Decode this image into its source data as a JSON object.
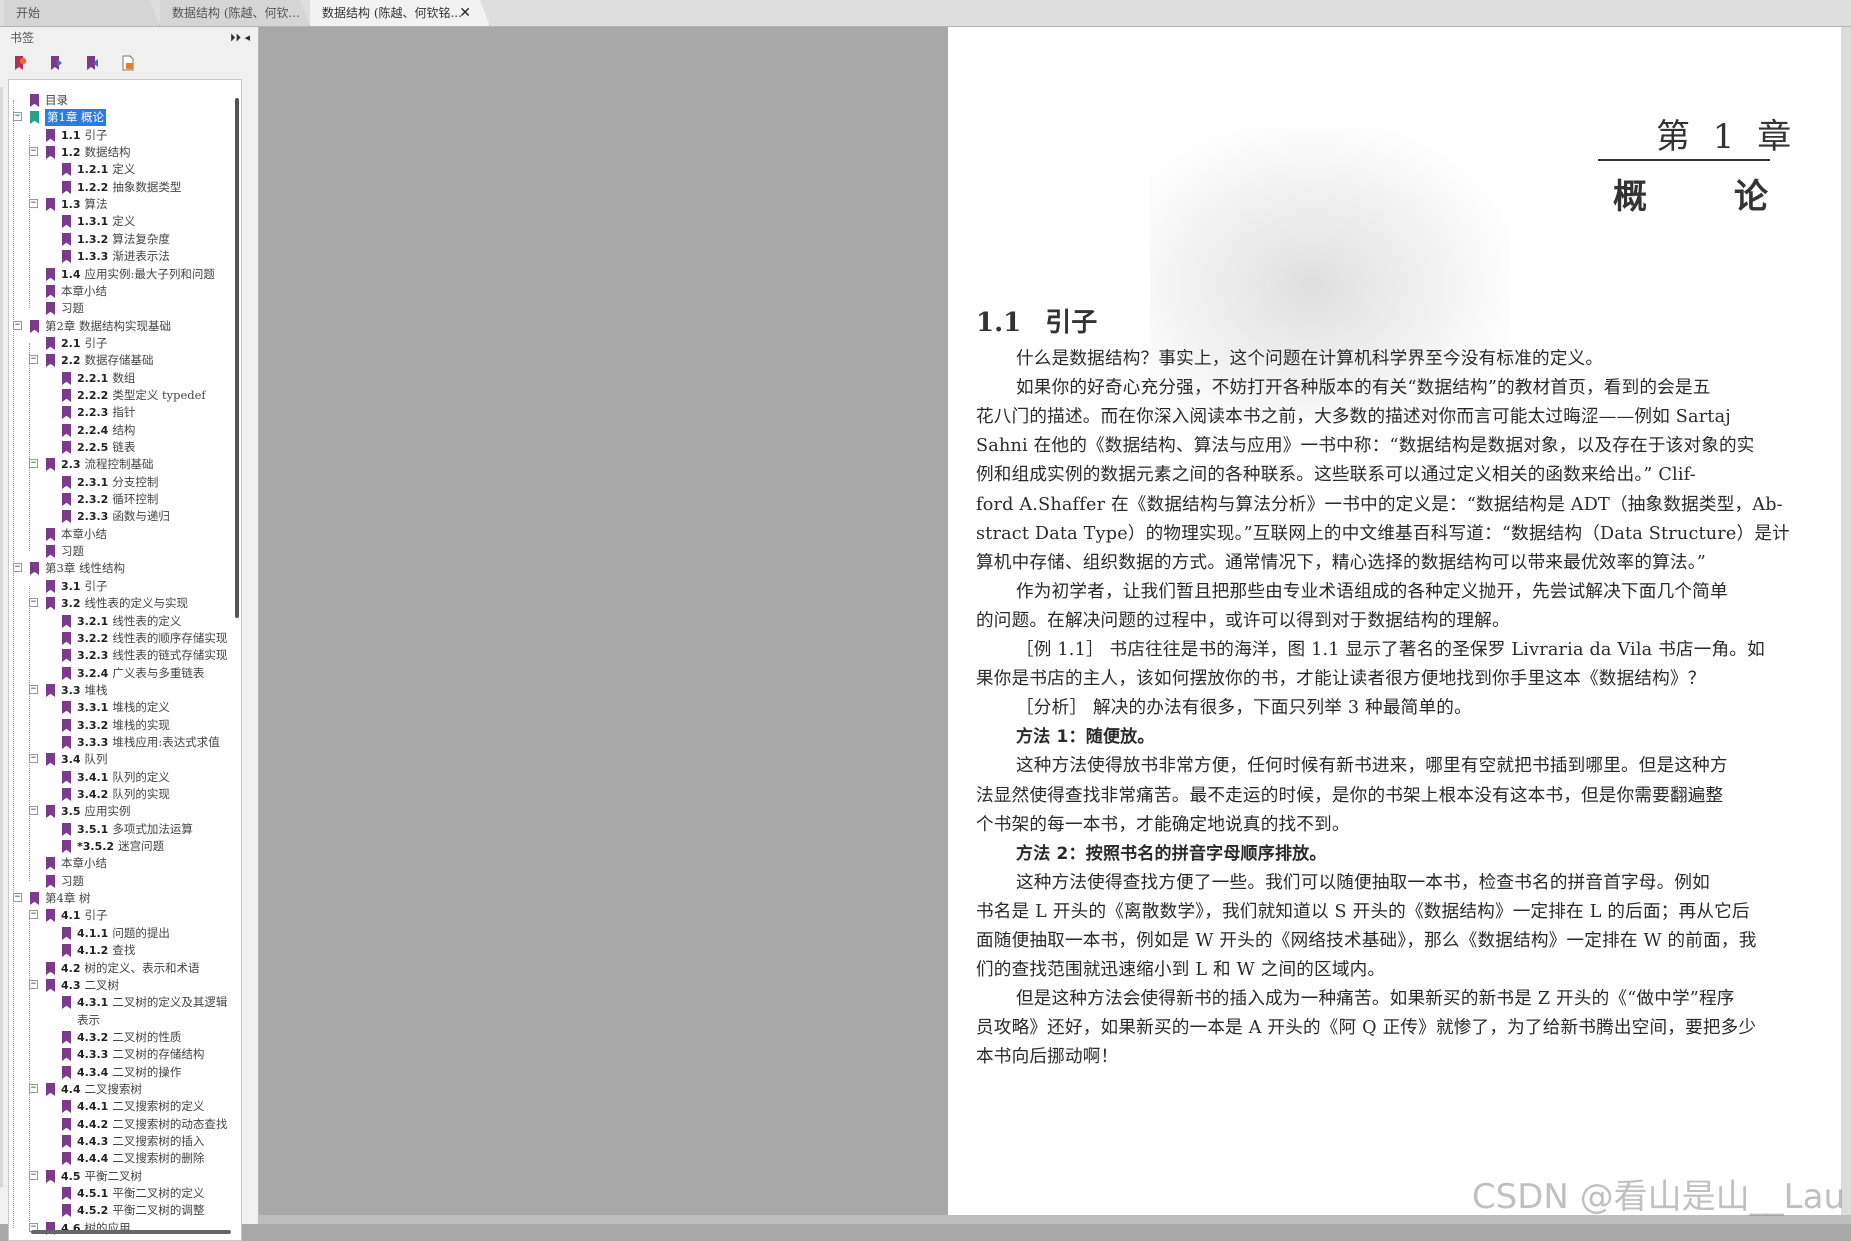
{
  "tabs": [
    {
      "label": "开始"
    },
    {
      "label": "数据结构 (陈越、何钦..."
    },
    {
      "label": "数据结构 (陈越、何钦铭..."
    }
  ],
  "tab_close_glyph": "✕",
  "sidebar": {
    "title": "书签",
    "panel_controls": "⏵⏵ ◂",
    "tools": [
      "bookmark-add-icon",
      "bookmark-next-icon",
      "bookmark-prev-icon",
      "bookmark-page-icon"
    ],
    "bookmark_color": "#7b3a8c",
    "selected_color": "#2c7be5",
    "items": [
      {
        "num": "",
        "label": "目录",
        "level": 0,
        "toggle": ""
      },
      {
        "num": "",
        "label": "第1章 概论",
        "level": 0,
        "toggle": "−",
        "selected": true
      },
      {
        "num": "1.1",
        "label": "引子",
        "level": 1,
        "toggle": ""
      },
      {
        "num": "1.2",
        "label": "数据结构",
        "level": 1,
        "toggle": "−"
      },
      {
        "num": "1.2.1",
        "label": "定义",
        "level": 2,
        "toggle": ""
      },
      {
        "num": "1.2.2",
        "label": "抽象数据类型",
        "level": 2,
        "toggle": ""
      },
      {
        "num": "1.3",
        "label": "算法",
        "level": 1,
        "toggle": "−"
      },
      {
        "num": "1.3.1",
        "label": "定义",
        "level": 2,
        "toggle": ""
      },
      {
        "num": "1.3.2",
        "label": "算法复杂度",
        "level": 2,
        "toggle": ""
      },
      {
        "num": "1.3.3",
        "label": "渐进表示法",
        "level": 2,
        "toggle": ""
      },
      {
        "num": "1.4",
        "label": "应用实例:最大子列和问题",
        "level": 1,
        "toggle": ""
      },
      {
        "num": "",
        "label": "本章小结",
        "level": 1,
        "toggle": ""
      },
      {
        "num": "",
        "label": "习题",
        "level": 1,
        "toggle": ""
      },
      {
        "num": "",
        "label": "第2章 数据结构实现基础",
        "level": 0,
        "toggle": "−"
      },
      {
        "num": "2.1",
        "label": "引子",
        "level": 1,
        "toggle": ""
      },
      {
        "num": "2.2",
        "label": "数据存储基础",
        "level": 1,
        "toggle": "−"
      },
      {
        "num": "2.2.1",
        "label": "数组",
        "level": 2,
        "toggle": ""
      },
      {
        "num": "2.2.2",
        "label": "类型定义 typedef",
        "level": 2,
        "toggle": ""
      },
      {
        "num": "2.2.3",
        "label": "指针",
        "level": 2,
        "toggle": ""
      },
      {
        "num": "2.2.4",
        "label": "结构",
        "level": 2,
        "toggle": ""
      },
      {
        "num": "2.2.5",
        "label": "链表",
        "level": 2,
        "toggle": ""
      },
      {
        "num": "2.3",
        "label": "流程控制基础",
        "level": 1,
        "toggle": "−"
      },
      {
        "num": "2.3.1",
        "label": "分支控制",
        "level": 2,
        "toggle": ""
      },
      {
        "num": "2.3.2",
        "label": "循环控制",
        "level": 2,
        "toggle": ""
      },
      {
        "num": "2.3.3",
        "label": "函数与递归",
        "level": 2,
        "toggle": ""
      },
      {
        "num": "",
        "label": "本章小结",
        "level": 1,
        "toggle": ""
      },
      {
        "num": "",
        "label": "习题",
        "level": 1,
        "toggle": ""
      },
      {
        "num": "",
        "label": "第3章 线性结构",
        "level": 0,
        "toggle": "−"
      },
      {
        "num": "3.1",
        "label": "引子",
        "level": 1,
        "toggle": ""
      },
      {
        "num": "3.2",
        "label": "线性表的定义与实现",
        "level": 1,
        "toggle": "−"
      },
      {
        "num": "3.2.1",
        "label": "线性表的定义",
        "level": 2,
        "toggle": ""
      },
      {
        "num": "3.2.2",
        "label": "线性表的顺序存储实现",
        "level": 2,
        "toggle": ""
      },
      {
        "num": "3.2.3",
        "label": "线性表的链式存储实现",
        "level": 2,
        "toggle": ""
      },
      {
        "num": "3.2.4",
        "label": "广义表与多重链表",
        "level": 2,
        "toggle": ""
      },
      {
        "num": "3.3",
        "label": "堆栈",
        "level": 1,
        "toggle": "−"
      },
      {
        "num": "3.3.1",
        "label": "堆栈的定义",
        "level": 2,
        "toggle": ""
      },
      {
        "num": "3.3.2",
        "label": "堆栈的实现",
        "level": 2,
        "toggle": ""
      },
      {
        "num": "3.3.3",
        "label": "堆栈应用:表达式求值",
        "level": 2,
        "toggle": ""
      },
      {
        "num": "3.4",
        "label": "队列",
        "level": 1,
        "toggle": "−"
      },
      {
        "num": "3.4.1",
        "label": "队列的定义",
        "level": 2,
        "toggle": ""
      },
      {
        "num": "3.4.2",
        "label": "队列的实现",
        "level": 2,
        "toggle": ""
      },
      {
        "num": "3.5",
        "label": "应用实例",
        "level": 1,
        "toggle": "−"
      },
      {
        "num": "3.5.1",
        "label": "多项式加法运算",
        "level": 2,
        "toggle": ""
      },
      {
        "num": "*3.5.2",
        "label": "迷宫问题",
        "level": 2,
        "toggle": ""
      },
      {
        "num": "",
        "label": "本章小结",
        "level": 1,
        "toggle": ""
      },
      {
        "num": "",
        "label": "习题",
        "level": 1,
        "toggle": ""
      },
      {
        "num": "",
        "label": "第4章 树",
        "level": 0,
        "toggle": "−"
      },
      {
        "num": "4.1",
        "label": "引子",
        "level": 1,
        "toggle": "−"
      },
      {
        "num": "4.1.1",
        "label": "问题的提出",
        "level": 2,
        "toggle": ""
      },
      {
        "num": "4.1.2",
        "label": "查找",
        "level": 2,
        "toggle": ""
      },
      {
        "num": "4.2",
        "label": "树的定义、表示和术语",
        "level": 1,
        "toggle": ""
      },
      {
        "num": "4.3",
        "label": "二叉树",
        "level": 1,
        "toggle": "−"
      },
      {
        "num": "4.3.1",
        "label": "二叉树的定义及其逻辑",
        "level": 2,
        "toggle": ""
      },
      {
        "num": "",
        "label": "表示",
        "level": 2,
        "toggle": "",
        "continuation": true
      },
      {
        "num": "4.3.2",
        "label": "二叉树的性质",
        "level": 2,
        "toggle": ""
      },
      {
        "num": "4.3.3",
        "label": "二叉树的存储结构",
        "level": 2,
        "toggle": ""
      },
      {
        "num": "4.3.4",
        "label": "二叉树的操作",
        "level": 2,
        "toggle": ""
      },
      {
        "num": "4.4",
        "label": "二叉搜索树",
        "level": 1,
        "toggle": "−"
      },
      {
        "num": "4.4.1",
        "label": "二叉搜索树的定义",
        "level": 2,
        "toggle": ""
      },
      {
        "num": "4.4.2",
        "label": "二叉搜索树的动态查找",
        "level": 2,
        "toggle": ""
      },
      {
        "num": "4.4.3",
        "label": "二叉搜索树的插入",
        "level": 2,
        "toggle": ""
      },
      {
        "num": "4.4.4",
        "label": "二叉搜索树的删除",
        "level": 2,
        "toggle": ""
      },
      {
        "num": "4.5",
        "label": "平衡二叉树",
        "level": 1,
        "toggle": "−"
      },
      {
        "num": "4.5.1",
        "label": "平衡二叉树的定义",
        "level": 2,
        "toggle": ""
      },
      {
        "num": "4.5.2",
        "label": "平衡二叉树的调整",
        "level": 2,
        "toggle": ""
      },
      {
        "num": "4.6",
        "label": "树的应用",
        "level": 1,
        "toggle": "−"
      }
    ]
  },
  "page": {
    "chapter_number": "第 1 章",
    "chapter_name_1": "概",
    "chapter_name_2": "论",
    "section_number": "1.1",
    "section_title": "引子",
    "lines": [
      {
        "text": "什么是数据结构？事实上，这个问题在计算机科学界至今没有标准的定义。",
        "indent": true
      },
      {
        "text": "如果你的好奇心充分强，不妨打开各种版本的有关“数据结构”的教材首页，看到的会是五",
        "indent": true
      },
      {
        "text": "花八门的描述。而在你深入阅读本书之前，大多数的描述对你而言可能太过晦涩——例如 Sartaj",
        "indent": false
      },
      {
        "text": "Sahni 在他的《数据结构、算法与应用》一书中称：“数据结构是数据对象，以及存在于该对象的实",
        "indent": false
      },
      {
        "text": "例和组成实例的数据元素之间的各种联系。这些联系可以通过定义相关的函数来给出。” Clif-",
        "indent": false
      },
      {
        "text": "ford A.Shaffer 在《数据结构与算法分析》一书中的定义是：“数据结构是 ADT（抽象数据类型，Ab-",
        "indent": false
      },
      {
        "text": "stract Data Type）的物理实现。”互联网上的中文维基百科写道：“数据结构（Data Structure）是计",
        "indent": false
      },
      {
        "text": "算机中存储、组织数据的方式。通常情况下，精心选择的数据结构可以带来最优效率的算法。”",
        "indent": false
      },
      {
        "text": "作为初学者，让我们暂且把那些由专业术语组成的各种定义抛开，先尝试解决下面几个简单",
        "indent": true
      },
      {
        "text": "的问题。在解决问题的过程中，或许可以得到对于数据结构的理解。",
        "indent": false
      },
      {
        "text": "［例 1.1］ 书店往往是书的海洋，图 1.1 显示了著名的圣保罗 Livraria da Vila 书店一角。如",
        "indent": true
      },
      {
        "text": "果你是书店的主人，该如何摆放你的书，才能让读者很方便地找到你手里这本《数据结构》？",
        "indent": false
      },
      {
        "text": "［分析］ 解决的办法有很多，下面只列举 3 种最简单的。",
        "indent": true
      },
      {
        "text": "方法 1：随便放。",
        "indent": true,
        "bold": true
      },
      {
        "text": "这种方法使得放书非常方便，任何时候有新书进来，哪里有空就把书插到哪里。但是这种方",
        "indent": true
      },
      {
        "text": "法显然使得查找非常痛苦。最不走运的时候，是你的书架上根本没有这本书，但是你需要翻遍整",
        "indent": false
      },
      {
        "text": "个书架的每一本书，才能确定地说真的找不到。",
        "indent": false
      },
      {
        "text": "方法 2：按照书名的拼音字母顺序排放。",
        "indent": true,
        "bold": true
      },
      {
        "text": "这种方法使得查找方便了一些。我们可以随便抽取一本书，检查书名的拼音首字母。例如",
        "indent": true
      },
      {
        "text": "书名是 L 开头的《离散数学》，我们就知道以 S 开头的《数据结构》一定排在 L 的后面；再从它后",
        "indent": false
      },
      {
        "text": "面随便抽取一本书，例如是 W 开头的《网络技术基础》，那么《数据结构》一定排在 W 的前面，我",
        "indent": false
      },
      {
        "text": "们的查找范围就迅速缩小到 L 和 W 之间的区域内。",
        "indent": false
      },
      {
        "text": "但是这种方法会使得新书的插入成为一种痛苦。如果新买的新书是 Z 开头的《“做中学”程序",
        "indent": true
      },
      {
        "text": "员攻略》还好，如果新买的一本是 A 开头的《阿 Q 正传》就惨了，为了给新书腾出空间，要把多少",
        "indent": false
      },
      {
        "text": "本书向后挪动啊！",
        "indent": false
      }
    ]
  },
  "watermark": "CSDN @看山是山__Lau"
}
